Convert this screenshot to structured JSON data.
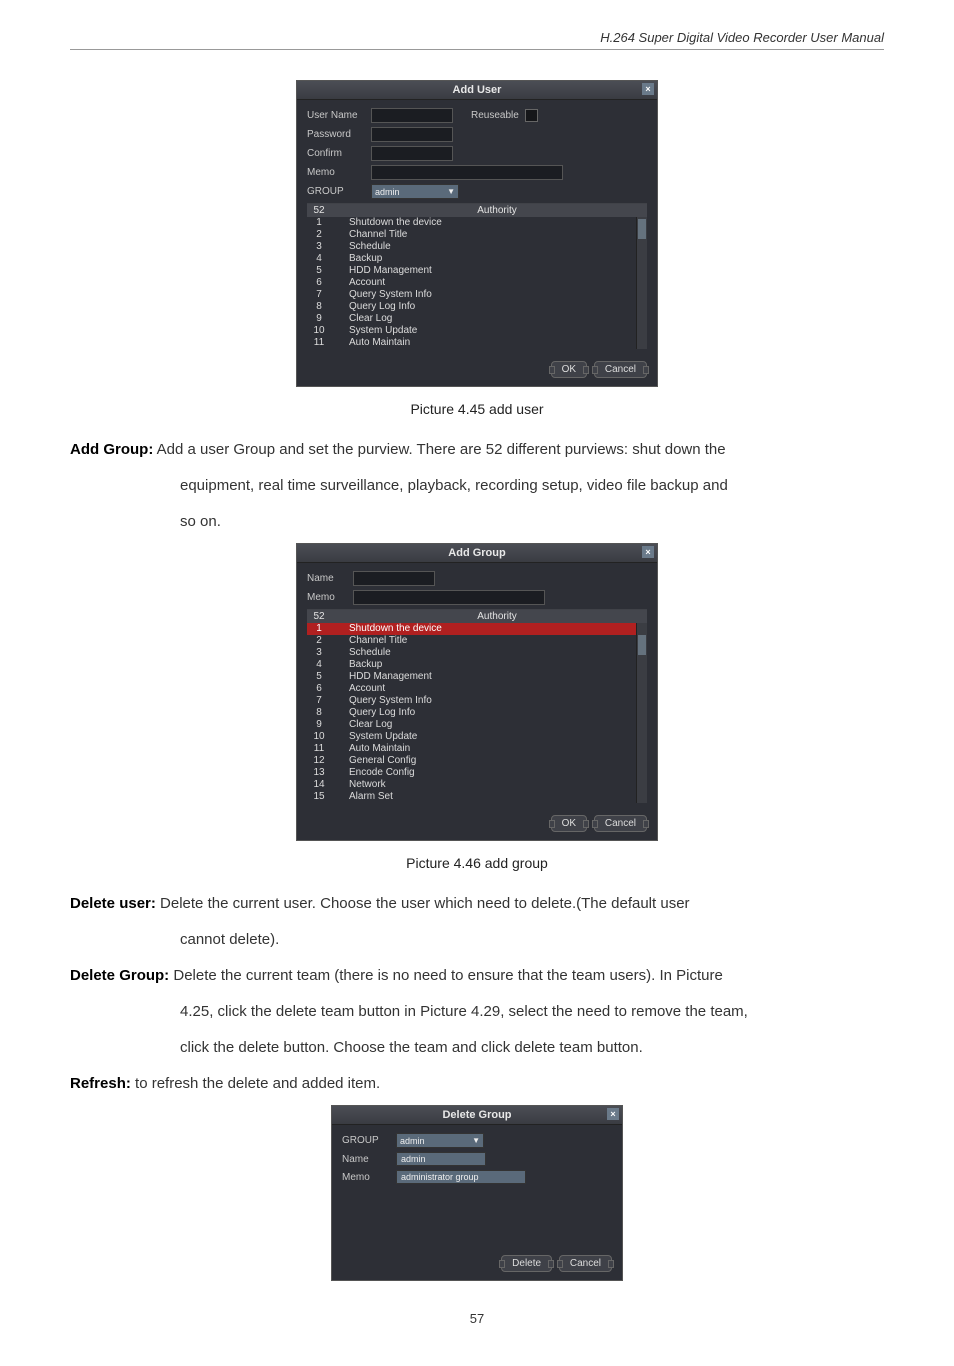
{
  "header": "H.264 Super Digital Video Recorder User Manual",
  "pageNumber": "57",
  "captions": {
    "addUser": "Picture 4.45 add user",
    "addGroup": "Picture 4.46 add group"
  },
  "para": {
    "addGroupLabel": "Add Group:",
    "addGroupText1": " Add a user Group and set the purview. There are 52 different purviews: shut down the",
    "addGroupText2": "equipment, real time surveillance, playback, recording setup, video file backup and",
    "addGroupText3": "so on.",
    "deleteUserLabel": "Delete user:",
    "deleteUserText1": " Delete the current user. Choose the user which need to delete.(The default user",
    "deleteUserText2": "cannot delete).",
    "deleteGroupLabel": "Delete Group:",
    "deleteGroupText1": " Delete the current team (there is no need to ensure that the team users). In Picture",
    "deleteGroupText2": "4.25, click the delete team button in Picture 4.29, select the need to remove the team,",
    "deleteGroupText3": "click the delete button. Choose the team and click delete team button.",
    "refreshLabel": "Refresh:",
    "refreshText": " to refresh the delete and added item."
  },
  "addUserDialog": {
    "title": "Add User",
    "labels": {
      "userName": "User Name",
      "reuseable": "Reuseable",
      "password": "Password",
      "confirm": "Confirm",
      "memo": "Memo",
      "group": "GROUP"
    },
    "groupValue": "admin",
    "count": "52",
    "authorityHeader": "Authority",
    "items": [
      {
        "idx": "1",
        "label": "Shutdown the device"
      },
      {
        "idx": "2",
        "label": "Channel Title"
      },
      {
        "idx": "3",
        "label": "Schedule"
      },
      {
        "idx": "4",
        "label": "Backup"
      },
      {
        "idx": "5",
        "label": "HDD Management"
      },
      {
        "idx": "6",
        "label": "Account"
      },
      {
        "idx": "7",
        "label": "Query System Info"
      },
      {
        "idx": "8",
        "label": "Query Log Info"
      },
      {
        "idx": "9",
        "label": "Clear Log"
      },
      {
        "idx": "10",
        "label": "System Update"
      },
      {
        "idx": "11",
        "label": "Auto Maintain"
      }
    ],
    "ok": "OK",
    "cancel": "Cancel"
  },
  "addGroupDialog": {
    "title": "Add Group",
    "labels": {
      "name": "Name",
      "memo": "Memo"
    },
    "count": "52",
    "authorityHeader": "Authority",
    "selectedIndex": 0,
    "items": [
      {
        "idx": "1",
        "label": "Shutdown the device"
      },
      {
        "idx": "2",
        "label": "Channel Title"
      },
      {
        "idx": "3",
        "label": "Schedule"
      },
      {
        "idx": "4",
        "label": "Backup"
      },
      {
        "idx": "5",
        "label": "HDD Management"
      },
      {
        "idx": "6",
        "label": "Account"
      },
      {
        "idx": "7",
        "label": "Query System Info"
      },
      {
        "idx": "8",
        "label": "Query Log Info"
      },
      {
        "idx": "9",
        "label": "Clear Log"
      },
      {
        "idx": "10",
        "label": "System Update"
      },
      {
        "idx": "11",
        "label": "Auto Maintain"
      },
      {
        "idx": "12",
        "label": "General Config"
      },
      {
        "idx": "13",
        "label": "Encode Config"
      },
      {
        "idx": "14",
        "label": "Network"
      },
      {
        "idx": "15",
        "label": "Alarm Set"
      }
    ],
    "ok": "OK",
    "cancel": "Cancel"
  },
  "deleteGroupDialog": {
    "title": "Delete Group",
    "labels": {
      "group": "GROUP",
      "name": "Name",
      "memo": "Memo"
    },
    "groupValue": "admin",
    "nameValue": "admin",
    "memoValue": "administrator group",
    "delete": "Delete",
    "cancel": "Cancel"
  }
}
